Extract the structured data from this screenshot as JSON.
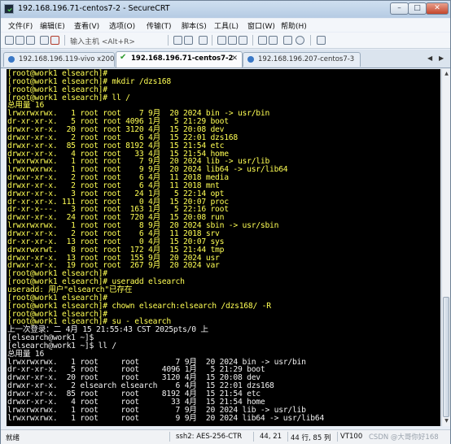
{
  "window": {
    "title": "192.168.196.71-centos7-2 - SecureCRT"
  },
  "menu": [
    "文件(F)",
    "编辑(E)",
    "查看(V)",
    "选项(O)",
    "传输(T)",
    "脚本(S)",
    "工具(L)",
    "窗口(W)",
    "帮助(H)"
  ],
  "toolbar": {
    "quick_connect_placeholder": "输入主机 <Alt+R>"
  },
  "tabs": [
    {
      "label": "192.168.196.119-vivo x200",
      "active": false
    },
    {
      "label": "192.168.196.71-centos7-2",
      "active": true
    },
    {
      "label": "192.168.196.207-centos7-3",
      "active": false
    }
  ],
  "terminal_lines": [
    {
      "text": "[root@work1 elsearch]#",
      "color": "#ffff54"
    },
    {
      "text": "[root@work1 elsearch]# mkdir /dzs168",
      "color": "#ffff54"
    },
    {
      "text": "[root@work1 elsearch]#",
      "color": "#ffff54"
    },
    {
      "text": "[root@work1 elsearch]# ll /",
      "color": "#ffff54"
    },
    {
      "text": "总用量 16",
      "color": "#ffff54"
    },
    {
      "text": "lrwxrwxrwx.   1 root root    7 9月  20 2024 bin -> usr/bin",
      "color": "#ffff54"
    },
    {
      "text": "dr-xr-xr-x.   5 root root 4096 1月   5 21:29 boot",
      "color": "#ffff54"
    },
    {
      "text": "drwxr-xr-x.  20 root root 3120 4月  15 20:08 dev",
      "color": "#ffff54"
    },
    {
      "text": "drwxr-xr-x.   2 root root    6 4月  15 22:01 dzs168",
      "color": "#ffff54"
    },
    {
      "text": "drwxr-xr-x.  85 root root 8192 4月  15 21:54 etc",
      "color": "#ffff54"
    },
    {
      "text": "drwxr-xr-x.   4 root root   33 4月  15 21:54 home",
      "color": "#ffff54"
    },
    {
      "text": "lrwxrwxrwx.   1 root root    7 9月  20 2024 lib -> usr/lib",
      "color": "#ffff54"
    },
    {
      "text": "lrwxrwxrwx.   1 root root    9 9月  20 2024 lib64 -> usr/lib64",
      "color": "#ffff54"
    },
    {
      "text": "drwxr-xr-x.   2 root root    6 4月  11 2018 media",
      "color": "#ffff54"
    },
    {
      "text": "drwxr-xr-x.   2 root root    6 4月  11 2018 mnt",
      "color": "#ffff54"
    },
    {
      "text": "drwxr-xr-x.   3 root root   24 1月   5 22:14 opt",
      "color": "#ffff54"
    },
    {
      "text": "dr-xr-xr-x. 111 root root    0 4月  15 20:07 proc",
      "color": "#ffff54"
    },
    {
      "text": "dr-xr-x---.   3 root root  163 1月   5 22:16 root",
      "color": "#ffff54"
    },
    {
      "text": "drwxr-xr-x.  24 root root  720 4月  15 20:08 run",
      "color": "#ffff54"
    },
    {
      "text": "lrwxrwxrwx.   1 root root    8 9月  20 2024 sbin -> usr/sbin",
      "color": "#ffff54"
    },
    {
      "text": "drwxr-xr-x.   2 root root    6 4月  11 2018 srv",
      "color": "#ffff54"
    },
    {
      "text": "dr-xr-xr-x.  13 root root    0 4月  15 20:07 sys",
      "color": "#ffff54"
    },
    {
      "text": "drwxrwxrwt.   8 root root  172 4月  15 21:44 tmp",
      "color": "#ffff54"
    },
    {
      "text": "drwxr-xr-x.  13 root root  155 9月  20 2024 usr",
      "color": "#ffff54"
    },
    {
      "text": "drwxr-xr-x.  19 root root  267 9月  20 2024 var",
      "color": "#ffff54"
    },
    {
      "text": "[root@work1 elsearch]#",
      "color": "#ffff54"
    },
    {
      "text": "[root@work1 elsearch]# useradd elsearch",
      "color": "#ffff54"
    },
    {
      "text": "useradd: 用户\"elsearch\"已存在",
      "color": "#ffff54"
    },
    {
      "text": "[root@work1 elsearch]#",
      "color": "#ffff54"
    },
    {
      "text": "[root@work1 elsearch]# chown elsearch:elsearch /dzs168/ -R",
      "color": "#ffff54"
    },
    {
      "text": "[root@work1 elsearch]#",
      "color": "#ffff54"
    },
    {
      "text": "[root@work1 elsearch]# su - elsearch",
      "color": "#ffff54"
    },
    {
      "text": "上一次登录：二 4月 15 21:55:43 CST 2025pts/0 上",
      "color": "#f0f0f0"
    },
    {
      "text": "[elsearch@work1 ~]$",
      "color": "#f0f0f0"
    },
    {
      "text": "[elsearch@work1 ~]$ ll /",
      "color": "#f0f0f0"
    },
    {
      "text": "总用量 16",
      "color": "#f0f0f0"
    },
    {
      "text": "lrwxrwxrwx.   1 root     root        7 9月  20 2024 bin -> usr/bin",
      "color": "#f0f0f0"
    },
    {
      "text": "dr-xr-xr-x.   5 root     root     4096 1月   5 21:29 boot",
      "color": "#f0f0f0"
    },
    {
      "text": "drwxr-xr-x.  20 root     root     3120 4月  15 20:08 dev",
      "color": "#f0f0f0"
    },
    {
      "text": "drwxr-xr-x.   2 elsearch elsearch    6 4月  15 22:01 dzs168",
      "color": "#f0f0f0"
    },
    {
      "text": "drwxr-xr-x.  85 root     root     8192 4月  15 21:54 etc",
      "color": "#f0f0f0"
    },
    {
      "text": "drwxr-xr-x.   4 root     root       33 4月  15 21:54 home",
      "color": "#f0f0f0"
    },
    {
      "text": "lrwxrwxrwx.   1 root     root        7 9月  20 2024 lib -> usr/lib",
      "color": "#f0f0f0"
    },
    {
      "text": "lrwxrwxrwx.   1 root     root        9 9月  20 2024 lib64 -> usr/lib64",
      "color": "#f0f0f0"
    }
  ],
  "status": {
    "ready": "就绪",
    "ssh": "ssh2: AES-256-CTR",
    "cursor_pos": "44, 21",
    "rows_cols": "44 行, 85 列",
    "term": "VT100",
    "watermark": "CSDN @大哥你好168"
  }
}
